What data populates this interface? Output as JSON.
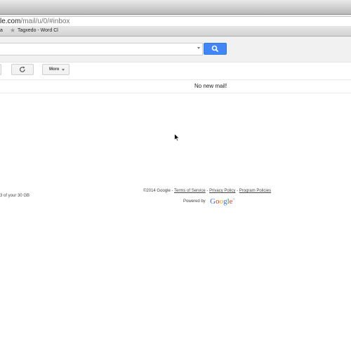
{
  "browser": {
    "url_host": "le.com",
    "url_path": "/mail/u/0/#inbox",
    "bookmarks": [
      {
        "label": "a"
      },
      {
        "label": "Tagxedo - Word Cl"
      }
    ]
  },
  "toolbar": {
    "more_label": "More"
  },
  "inbox": {
    "empty_message": "No new mail!"
  },
  "storage": {
    "usage_text": "3 of your 30 GB"
  },
  "footer": {
    "copyright": "©2014 Google",
    "sep1": " - ",
    "terms": "Terms of Service",
    "sep2": " - ",
    "privacy": "Privacy Policy",
    "sep3": " - ",
    "policies": "Program Policies",
    "powered_by": "Powered by",
    "logo": {
      "G": "G",
      "o1": "o",
      "o2": "o",
      "g": "g",
      "l": "l",
      "e": "e"
    }
  },
  "colors": {
    "search_button": "#4285f4",
    "logo_blue": "#3a6fd8",
    "logo_red": "#d6382d",
    "logo_yellow": "#e6a817",
    "logo_green": "#2b9d46"
  },
  "icons": [
    "bookmark-star-icon",
    "search-icon",
    "refresh-icon",
    "dropdown-caret-icon",
    "mouse-pointer-icon"
  ]
}
